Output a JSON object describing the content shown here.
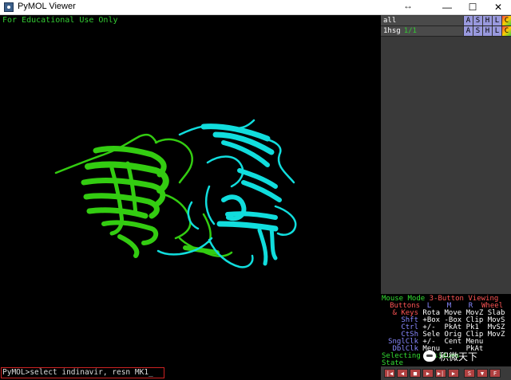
{
  "window": {
    "title": "PyMOL Viewer",
    "minimize_glyph": "—",
    "maximize_glyph": "☐",
    "close_glyph": "✕",
    "resize_glyph": "↔"
  },
  "viewer": {
    "banner": "For Educational Use Only",
    "chain_a_color": "#33cc11",
    "chain_b_color": "#11dddd"
  },
  "objects": [
    {
      "name": "all",
      "state": "",
      "buttons": [
        "A",
        "S",
        "H",
        "L",
        "C"
      ]
    },
    {
      "name": "1hsg",
      "state": "1/1",
      "buttons": [
        "A",
        "S",
        "H",
        "L",
        "C"
      ]
    }
  ],
  "mouse_panel": {
    "header_left": "Mouse Mode",
    "header_right": "3-Button Viewing",
    "col_headers": [
      "Buttons",
      "L",
      "M",
      "R",
      "Wheel"
    ],
    "rows": [
      {
        "key": "& Keys",
        "values": "Rota Move MovZ Slab"
      },
      {
        "key": "Shft",
        "values": "+Box -Box Clip MovS"
      },
      {
        "key": "Ctrl",
        "values": "+/-  PkAt Pk1  MvSZ"
      },
      {
        "key": "CtSh",
        "values": "Sele Orig Clip MovZ"
      },
      {
        "key": "SnglClk",
        "values": "+/-  Cent Menu"
      },
      {
        "key": "DblClk",
        "values": "Menu  -   PkAt"
      }
    ],
    "selecting": "Selecting Residues",
    "state": "State"
  },
  "command_line": {
    "prompt": "PyMOL>",
    "value": "select indinavir, resn MK1_"
  },
  "playback": {
    "buttons": [
      "|◀",
      "◀",
      "■",
      "▶",
      "▶|",
      "▶",
      "S",
      "▼",
      "F"
    ]
  },
  "watermark": {
    "text": "积微天下"
  }
}
